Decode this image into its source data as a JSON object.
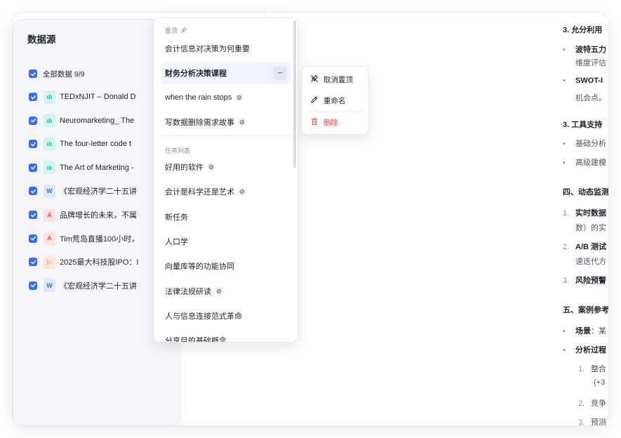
{
  "sources": {
    "title": "数据源",
    "all_label": "全部数据 9/9",
    "items": [
      {
        "type": "audio",
        "label": "TEDxNJIT – Donald D"
      },
      {
        "type": "audio",
        "label": "Neuromarketing_ The"
      },
      {
        "type": "audio",
        "label": "The four-letter code t"
      },
      {
        "type": "audio",
        "label": "The Art of Marketing -"
      },
      {
        "type": "word",
        "label": "《宏观经济学二十五讲"
      },
      {
        "type": "pdf",
        "label": "品牌增长的未来，不属"
      },
      {
        "type": "pdf",
        "label": "Tim荒岛直播100小时，"
      },
      {
        "type": "video",
        "label": "2025最大科技股IPO：I"
      },
      {
        "type": "word",
        "label": "《宏观经济学二十五讲"
      }
    ]
  },
  "menu": {
    "pinned_header": "置顶",
    "pinned": [
      {
        "label": "会计信息对决策为何重要",
        "shared": false
      },
      {
        "label": "财务分析决策课程",
        "shared": false,
        "active": true
      },
      {
        "label": "when the rain stops",
        "shared": true
      },
      {
        "label": "写数据删除需求故事",
        "shared": true
      }
    ],
    "tasks_header": "任务列表",
    "tasks": [
      {
        "label": "好用的软件",
        "shared": true
      },
      {
        "label": "会计是科学还是艺术",
        "shared": true
      },
      {
        "label": "新任务",
        "shared": false
      },
      {
        "label": "人口学",
        "shared": false
      },
      {
        "label": "向量库等的功能协同",
        "shared": false
      },
      {
        "label": "法律法规研读",
        "shared": true
      },
      {
        "label": "人与信息连接范式革命",
        "shared": false
      },
      {
        "label": "分享目的基础概念",
        "shared": false
      }
    ],
    "more_label": "···"
  },
  "context_menu": {
    "unpin": "取消置顶",
    "rename": "重命名",
    "delete": "删除"
  },
  "doc": {
    "top_cut": "3. 允分利用",
    "l1_bullet": "•",
    "l1_bold": "波特五力",
    "l1_cont": "维度评估",
    "l2_bullet": "•",
    "l2_bold": "SWOT-I",
    "l2_cont": "机会点。",
    "h3": "3. 工具支持",
    "t1_bullet": "•",
    "t1": "基础分析",
    "t2_bullet": "•",
    "t2": "高级建模",
    "h4": "四、动态监测",
    "o1_num": "1.",
    "o1_bold": "实时数据",
    "o1_cont": "数）的实",
    "o2_num": "2.",
    "o2_bold": "A/B 测试",
    "o2_cont": "速迭代方",
    "o3_num": "3.",
    "o3_bold": "风险预警",
    "h5": "五、案例参考",
    "c1_bullet": "•",
    "c1_bold": "场景",
    "c1_rest": "：某",
    "c2_bullet": "•",
    "c2_bold": "分析过程",
    "s1_num": "1.",
    "s1": "整合",
    "s1_cont": "(+3",
    "s2_num": "2.",
    "s2": "竞争",
    "s3_num": "3.",
    "s3": "预测"
  },
  "colors": {
    "accent": "#3b6cf6",
    "danger": "#ef4b4b",
    "panel_bg": "#f4f6fb",
    "active_bg": "#f1f4fd"
  }
}
